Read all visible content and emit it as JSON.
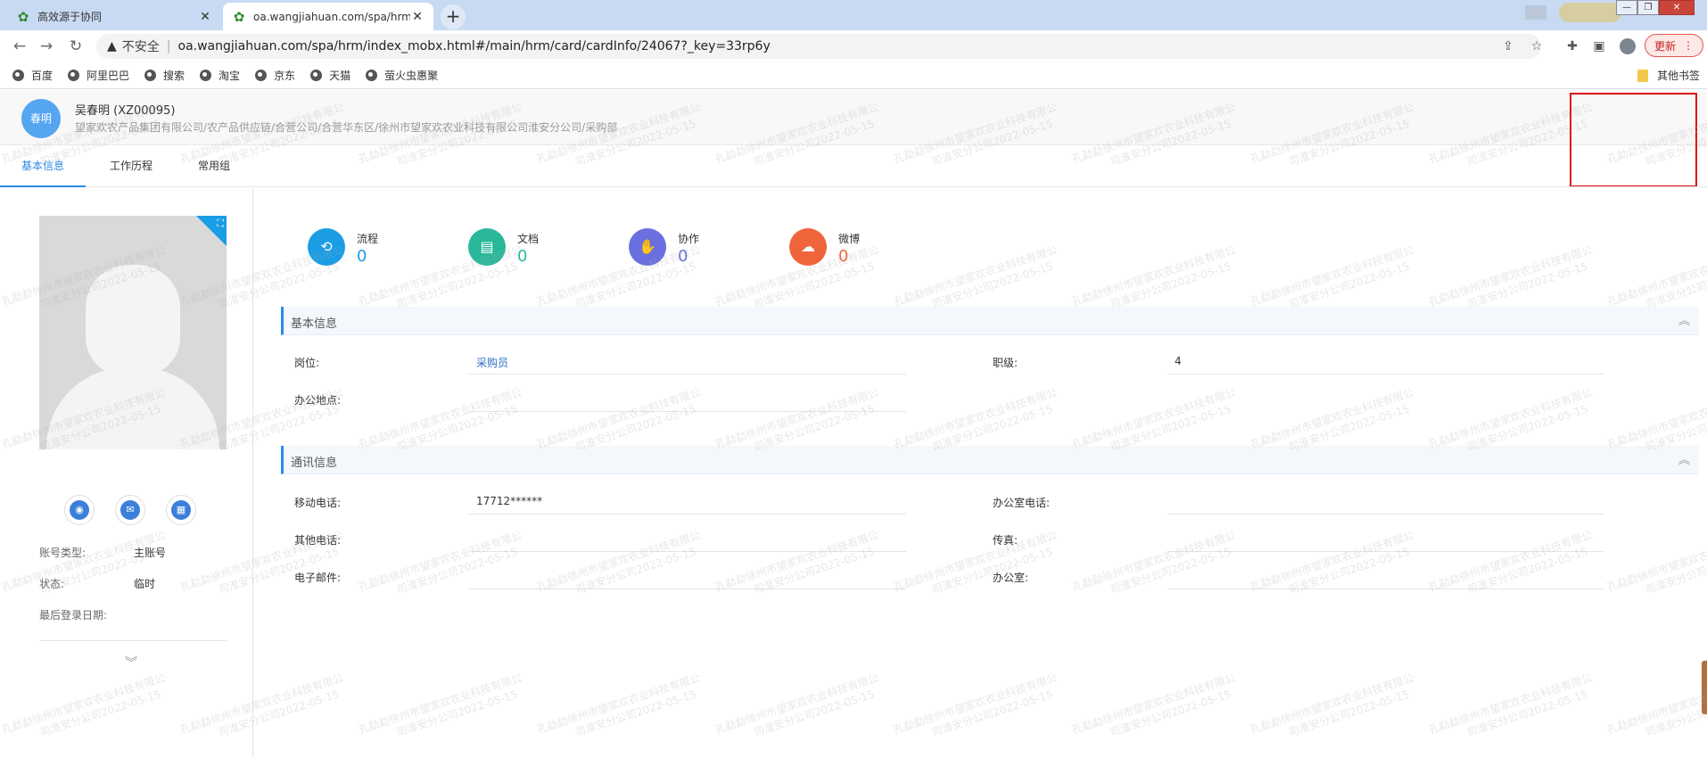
{
  "browser": {
    "tabs": [
      {
        "title": "高效源于协同",
        "active": false
      },
      {
        "title": "oa.wangjiahuan.com/spa/hrm/",
        "active": true
      }
    ],
    "new_tab": "+",
    "security_label": "不安全",
    "url_host": "oa.wangjiahuan.com",
    "url_path": "/spa/hrm/index_mobx.html#/main/hrm/card/cardInfo/24067?_key=33rp6y",
    "update_label": "更新",
    "bookmarks": [
      "百度",
      "阿里巴巴",
      "搜索",
      "淘宝",
      "京东",
      "天猫",
      "萤火虫惠聚"
    ],
    "other_bookmarks": "其他书签"
  },
  "user": {
    "avatar_text": "春明",
    "name": "吴春明 (XZ00095)",
    "org_path": "望家欢农产品集团有限公司/农产品供应链/合营公司/合营华东区/徐州市望家欢农业科技有限公司淮安分公司/采购部"
  },
  "tabs": [
    "基本信息",
    "工作历程",
    "常用组"
  ],
  "left": {
    "account_type_label": "账号类型:",
    "account_type_value": "主账号",
    "status_label": "状态:",
    "status_value": "临时",
    "last_login_label": "最后登录日期:",
    "last_login_value": ""
  },
  "stats": [
    {
      "label": "流程",
      "value": "0",
      "color": "#1a9de5"
    },
    {
      "label": "文档",
      "value": "0",
      "color": "#2bb89a"
    },
    {
      "label": "协作",
      "value": "0",
      "color": "#6a6fe0"
    },
    {
      "label": "微博",
      "value": "0",
      "color": "#f0643c"
    }
  ],
  "sections": {
    "basic": {
      "title": "基本信息",
      "position_label": "岗位:",
      "position_value": "采购员",
      "level_label": "职级:",
      "level_value": "4",
      "office_location_label": "办公地点:",
      "office_location_value": ""
    },
    "contact": {
      "title": "通讯信息",
      "mobile_label": "移动电话:",
      "mobile_value": "17712******",
      "office_phone_label": "办公室电话:",
      "office_phone_value": "",
      "other_phone_label": "其他电话:",
      "other_phone_value": "",
      "fax_label": "传真:",
      "fax_value": "",
      "email_label": "电子邮件:",
      "email_value": "",
      "office_label": "办公室:",
      "office_value": ""
    }
  },
  "watermark": {
    "line1": "孔勐勐徐州市望家欢农业科技有限公",
    "line2": "司淮安分公司2022-05-15"
  }
}
